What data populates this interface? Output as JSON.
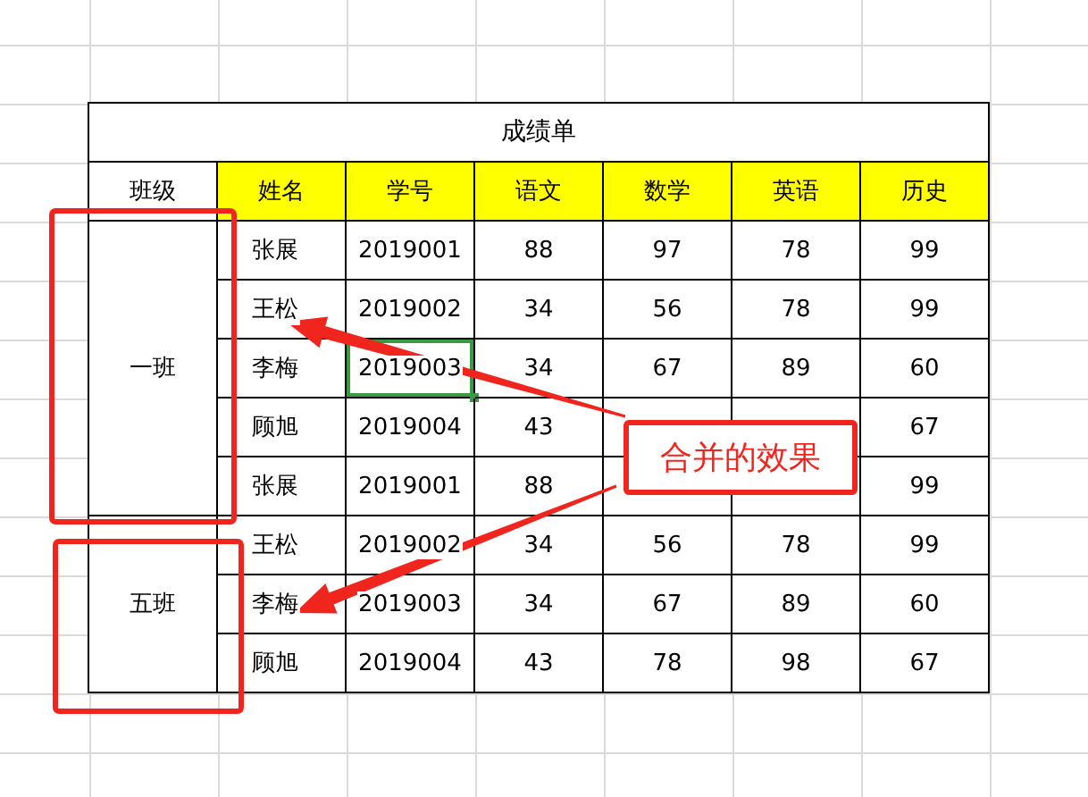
{
  "table": {
    "title": "成绩单",
    "columns": [
      "班级",
      "姓名",
      "学号",
      "语文",
      "数学",
      "英语",
      "历史"
    ],
    "groups": [
      {
        "label": "一班",
        "rows": [
          {
            "cells": [
              {
                "text": "张展",
                "selected": false
              },
              {
                "text": "2019001",
                "selected": false
              },
              {
                "text": "88",
                "selected": false
              },
              {
                "text": "97",
                "selected": false
              },
              {
                "text": "78",
                "selected": false
              },
              {
                "text": "99",
                "selected": false
              }
            ]
          },
          {
            "cells": [
              {
                "text": "王松",
                "selected": false
              },
              {
                "text": "2019002",
                "selected": false
              },
              {
                "text": "34",
                "selected": false
              },
              {
                "text": "56",
                "selected": false
              },
              {
                "text": "78",
                "selected": false
              },
              {
                "text": "99",
                "selected": false
              }
            ]
          },
          {
            "cells": [
              {
                "text": "李梅",
                "selected": false
              },
              {
                "text": "2019003",
                "selected": true
              },
              {
                "text": "34",
                "selected": false
              },
              {
                "text": "67",
                "selected": false
              },
              {
                "text": "89",
                "selected": false
              },
              {
                "text": "60",
                "selected": false
              }
            ]
          },
          {
            "cells": [
              {
                "text": "顾旭",
                "selected": false
              },
              {
                "text": "2019004",
                "selected": false
              },
              {
                "text": "43",
                "selected": false
              },
              {
                "selected": false
              },
              {
                "selected": false
              },
              {
                "text": "67",
                "selected": false
              }
            ]
          },
          {
            "cells": [
              {
                "text": "张展",
                "selected": false
              },
              {
                "text": "2019001",
                "selected": false
              },
              {
                "text": "88",
                "selected": false
              },
              {
                "selected": false
              },
              {
                "selected": false
              },
              {
                "text": "99",
                "selected": false
              }
            ]
          }
        ]
      },
      {
        "label": "五班",
        "rows": [
          {
            "cells": [
              {
                "text": "王松",
                "selected": false
              },
              {
                "text": "2019002",
                "selected": false
              },
              {
                "text": "34",
                "selected": false
              },
              {
                "text": "56",
                "selected": false
              },
              {
                "text": "78",
                "selected": false
              },
              {
                "text": "99",
                "selected": false
              }
            ]
          },
          {
            "cells": [
              {
                "text": "李梅",
                "selected": false
              },
              {
                "text": "2019003",
                "selected": false
              },
              {
                "text": "34",
                "selected": false
              },
              {
                "text": "67",
                "selected": false
              },
              {
                "text": "89",
                "selected": false
              },
              {
                "text": "60",
                "selected": false
              }
            ]
          },
          {
            "cells": [
              {
                "text": "顾旭",
                "selected": false
              },
              {
                "text": "2019004",
                "selected": false
              },
              {
                "text": "43",
                "selected": false
              },
              {
                "text": "78",
                "selected": false
              },
              {
                "text": "98",
                "selected": false
              },
              {
                "text": "67",
                "selected": false
              }
            ]
          }
        ]
      }
    ]
  },
  "annotation": {
    "text": "合并的效果"
  }
}
